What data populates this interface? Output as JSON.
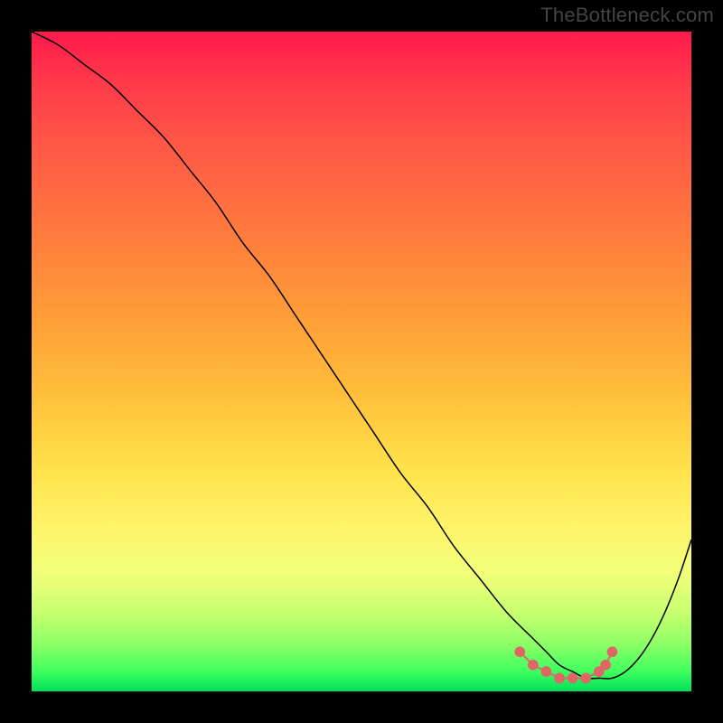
{
  "watermark": "TheBottleneck.com",
  "chart_data": {
    "type": "line",
    "title": "",
    "xlabel": "",
    "ylabel": "",
    "xlim": [
      0,
      100
    ],
    "ylim": [
      0,
      100
    ],
    "grid": false,
    "legend": false,
    "background": "traffic-light-gradient",
    "series": [
      {
        "name": "bottleneck-curve",
        "color": "#000000",
        "x": [
          0,
          4,
          8,
          12,
          16,
          20,
          24,
          28,
          32,
          36,
          40,
          44,
          48,
          52,
          56,
          60,
          64,
          68,
          72,
          76,
          78,
          80,
          82,
          84,
          86,
          88,
          90,
          92,
          94,
          96,
          98,
          100
        ],
        "y": [
          100,
          98,
          95,
          92,
          88,
          84,
          79,
          74,
          68,
          63,
          57,
          51,
          45,
          39,
          33,
          28,
          22,
          17,
          12,
          8,
          6,
          4,
          3,
          2,
          2,
          2,
          3,
          5,
          8,
          12,
          17,
          23
        ]
      },
      {
        "name": "valley-markers",
        "color": "#e06666",
        "type": "scatter",
        "x": [
          74,
          76,
          78,
          80,
          82,
          84,
          86,
          87,
          88
        ],
        "y": [
          6,
          4,
          3,
          2,
          2,
          2,
          3,
          4,
          6
        ]
      }
    ]
  }
}
